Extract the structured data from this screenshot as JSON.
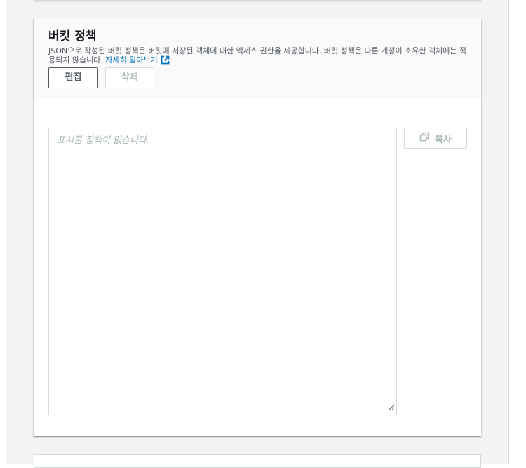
{
  "bucket_policy": {
    "title": "버킷 정책",
    "description": "JSON으로 작성된 버킷 정책은 버킷에 저장된 객체에 대한 액세스 권한을 제공합니다. 버킷 정책은 다른 계정이 소유한 객체에는 적용되지 않습니다.",
    "learn_more": "자세히 알아보기",
    "buttons": {
      "edit": "편집",
      "delete": "삭제"
    },
    "editor": {
      "placeholder": "표시할 정책이 없습니다."
    },
    "copy": "복사"
  },
  "icons": {
    "external_link": "external-link-icon",
    "copy": "copy-icon",
    "resize": "resize-handle-icon"
  },
  "colors": {
    "link": "#0073bb",
    "title": "#16191f",
    "text": "#545b64",
    "disabled": "#aab7b8"
  }
}
